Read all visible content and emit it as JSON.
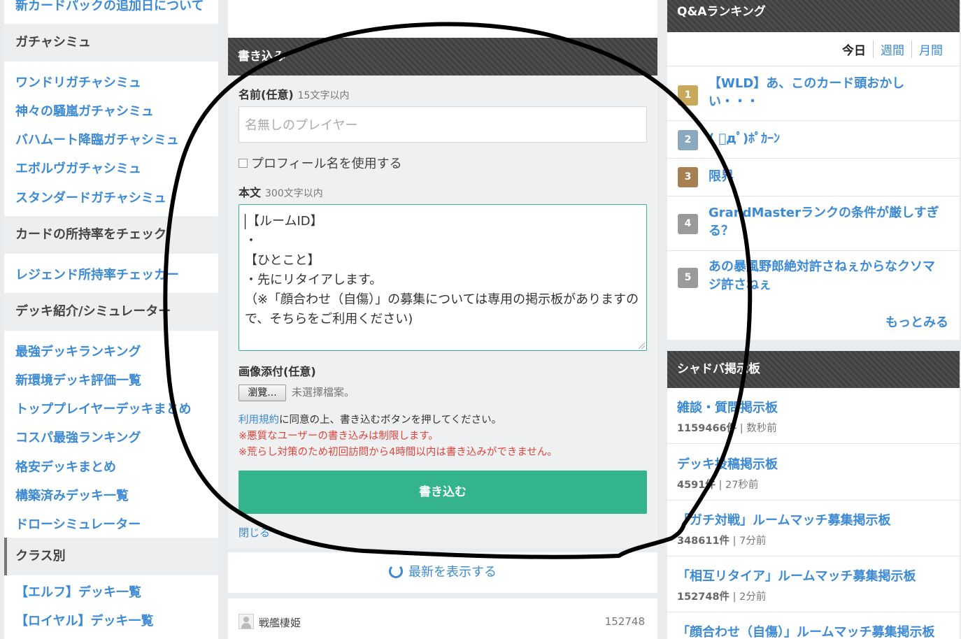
{
  "sidebar": {
    "top_link": "新カードパックの追加日について",
    "sections": [
      {
        "title": "ガチャシミュ",
        "items": [
          "ワンドリガチャシミュ",
          "神々の騒嵐ガチャシミュ",
          "バハムート降臨ガチャシミュ",
          "エボルヴガチャシミュ",
          "スタンダードガチャシミュ"
        ]
      },
      {
        "title": "カードの所持率をチェック",
        "items": [
          "レジェンド所持率チェッカー"
        ]
      },
      {
        "title": "デッキ紹介/シミュレーター",
        "items": [
          "最強デッキランキング",
          "新環境デッキ評価一覧",
          "トッププレイヤーデッキまとめ",
          "コスパ最強ランキング",
          "格安デッキまとめ",
          "構築済みデッキ一覧",
          "ドローシミュレーター"
        ]
      },
      {
        "title": "クラス別",
        "items": [
          "【エルフ】デッキ一覧",
          "【ロイヤル】デッキ一覧"
        ]
      }
    ]
  },
  "form": {
    "header": "書き込み",
    "name_label": "名前(任意)",
    "name_hint": "15文字以内",
    "name_placeholder": "名無しのプレイヤー",
    "profile_checkbox_label": "プロフィール名を使用する",
    "body_label": "本文",
    "body_hint": "300文字以内",
    "body_lines": [
      "【ルームID】",
      "・",
      "【ひとこと】",
      "・先にリタイアします。",
      "（※「顔合わせ（自傷）」の募集については専用の掲示板がありますので、そちらをご利用ください)"
    ],
    "image_label": "画像添付(任意)",
    "file_button": "瀏覽...",
    "file_status": "未選擇檔案。",
    "terms_link": "利用規約",
    "terms_text": "に同意の上、書き込むボタンを押してください。",
    "warning_1": "※悪質なユーザーの書き込みは制限します。",
    "warning_2": "※荒らし対策のため初回訪問から4時間以内は書き込みができません。",
    "submit": "書き込む",
    "close": "閉じる"
  },
  "refresh": {
    "label": "最新を表示する"
  },
  "latest_post": {
    "user": "戦艦棲姫",
    "number": "152748"
  },
  "qa_ranking": {
    "header": "Q&Aランキング",
    "tabs": [
      "今日",
      "週間",
      "月間"
    ],
    "items": [
      {
        "rank": "1",
        "text": "【WLD】あ、このカード頭おかしい・・・",
        "color": "#c9a85a"
      },
      {
        "rank": "2",
        "text": "( ﾟдﾟ)ﾎﾟｶｰﾝ",
        "color": "#8aa9bf"
      },
      {
        "rank": "3",
        "text": "限界",
        "color": "#a87f52"
      },
      {
        "rank": "4",
        "text": "GrandMasterランクの条件が厳しすぎる？",
        "color": "#9a9a9a"
      },
      {
        "rank": "5",
        "text": "あの暴風野郎絶対許さねぇからなクソマジ許さねぇ",
        "color": "#9a9a9a"
      }
    ],
    "more": "もっとみる"
  },
  "bbs": {
    "header": "シャドバ掲示板",
    "items": [
      {
        "title": "雑談・質問掲示板",
        "count": "1159466件",
        "time": "数秒前"
      },
      {
        "title": "デッキ投稿掲示板",
        "count": "4591件",
        "time": "27秒前"
      },
      {
        "title": "「ガチ対戦」ルームマッチ募集掲示板",
        "count": "348611件",
        "time": "7分前"
      },
      {
        "title": "「相互リタイア」ルームマッチ募集掲示板",
        "count": "152748件",
        "time": "2分前"
      },
      {
        "title": "「顔合わせ（自傷）」ルームマッチ募集掲示板",
        "count": "",
        "time": ""
      }
    ]
  },
  "colors": {
    "link": "#3c8ad6",
    "accent": "#33b48d",
    "warning": "#e0443a"
  }
}
